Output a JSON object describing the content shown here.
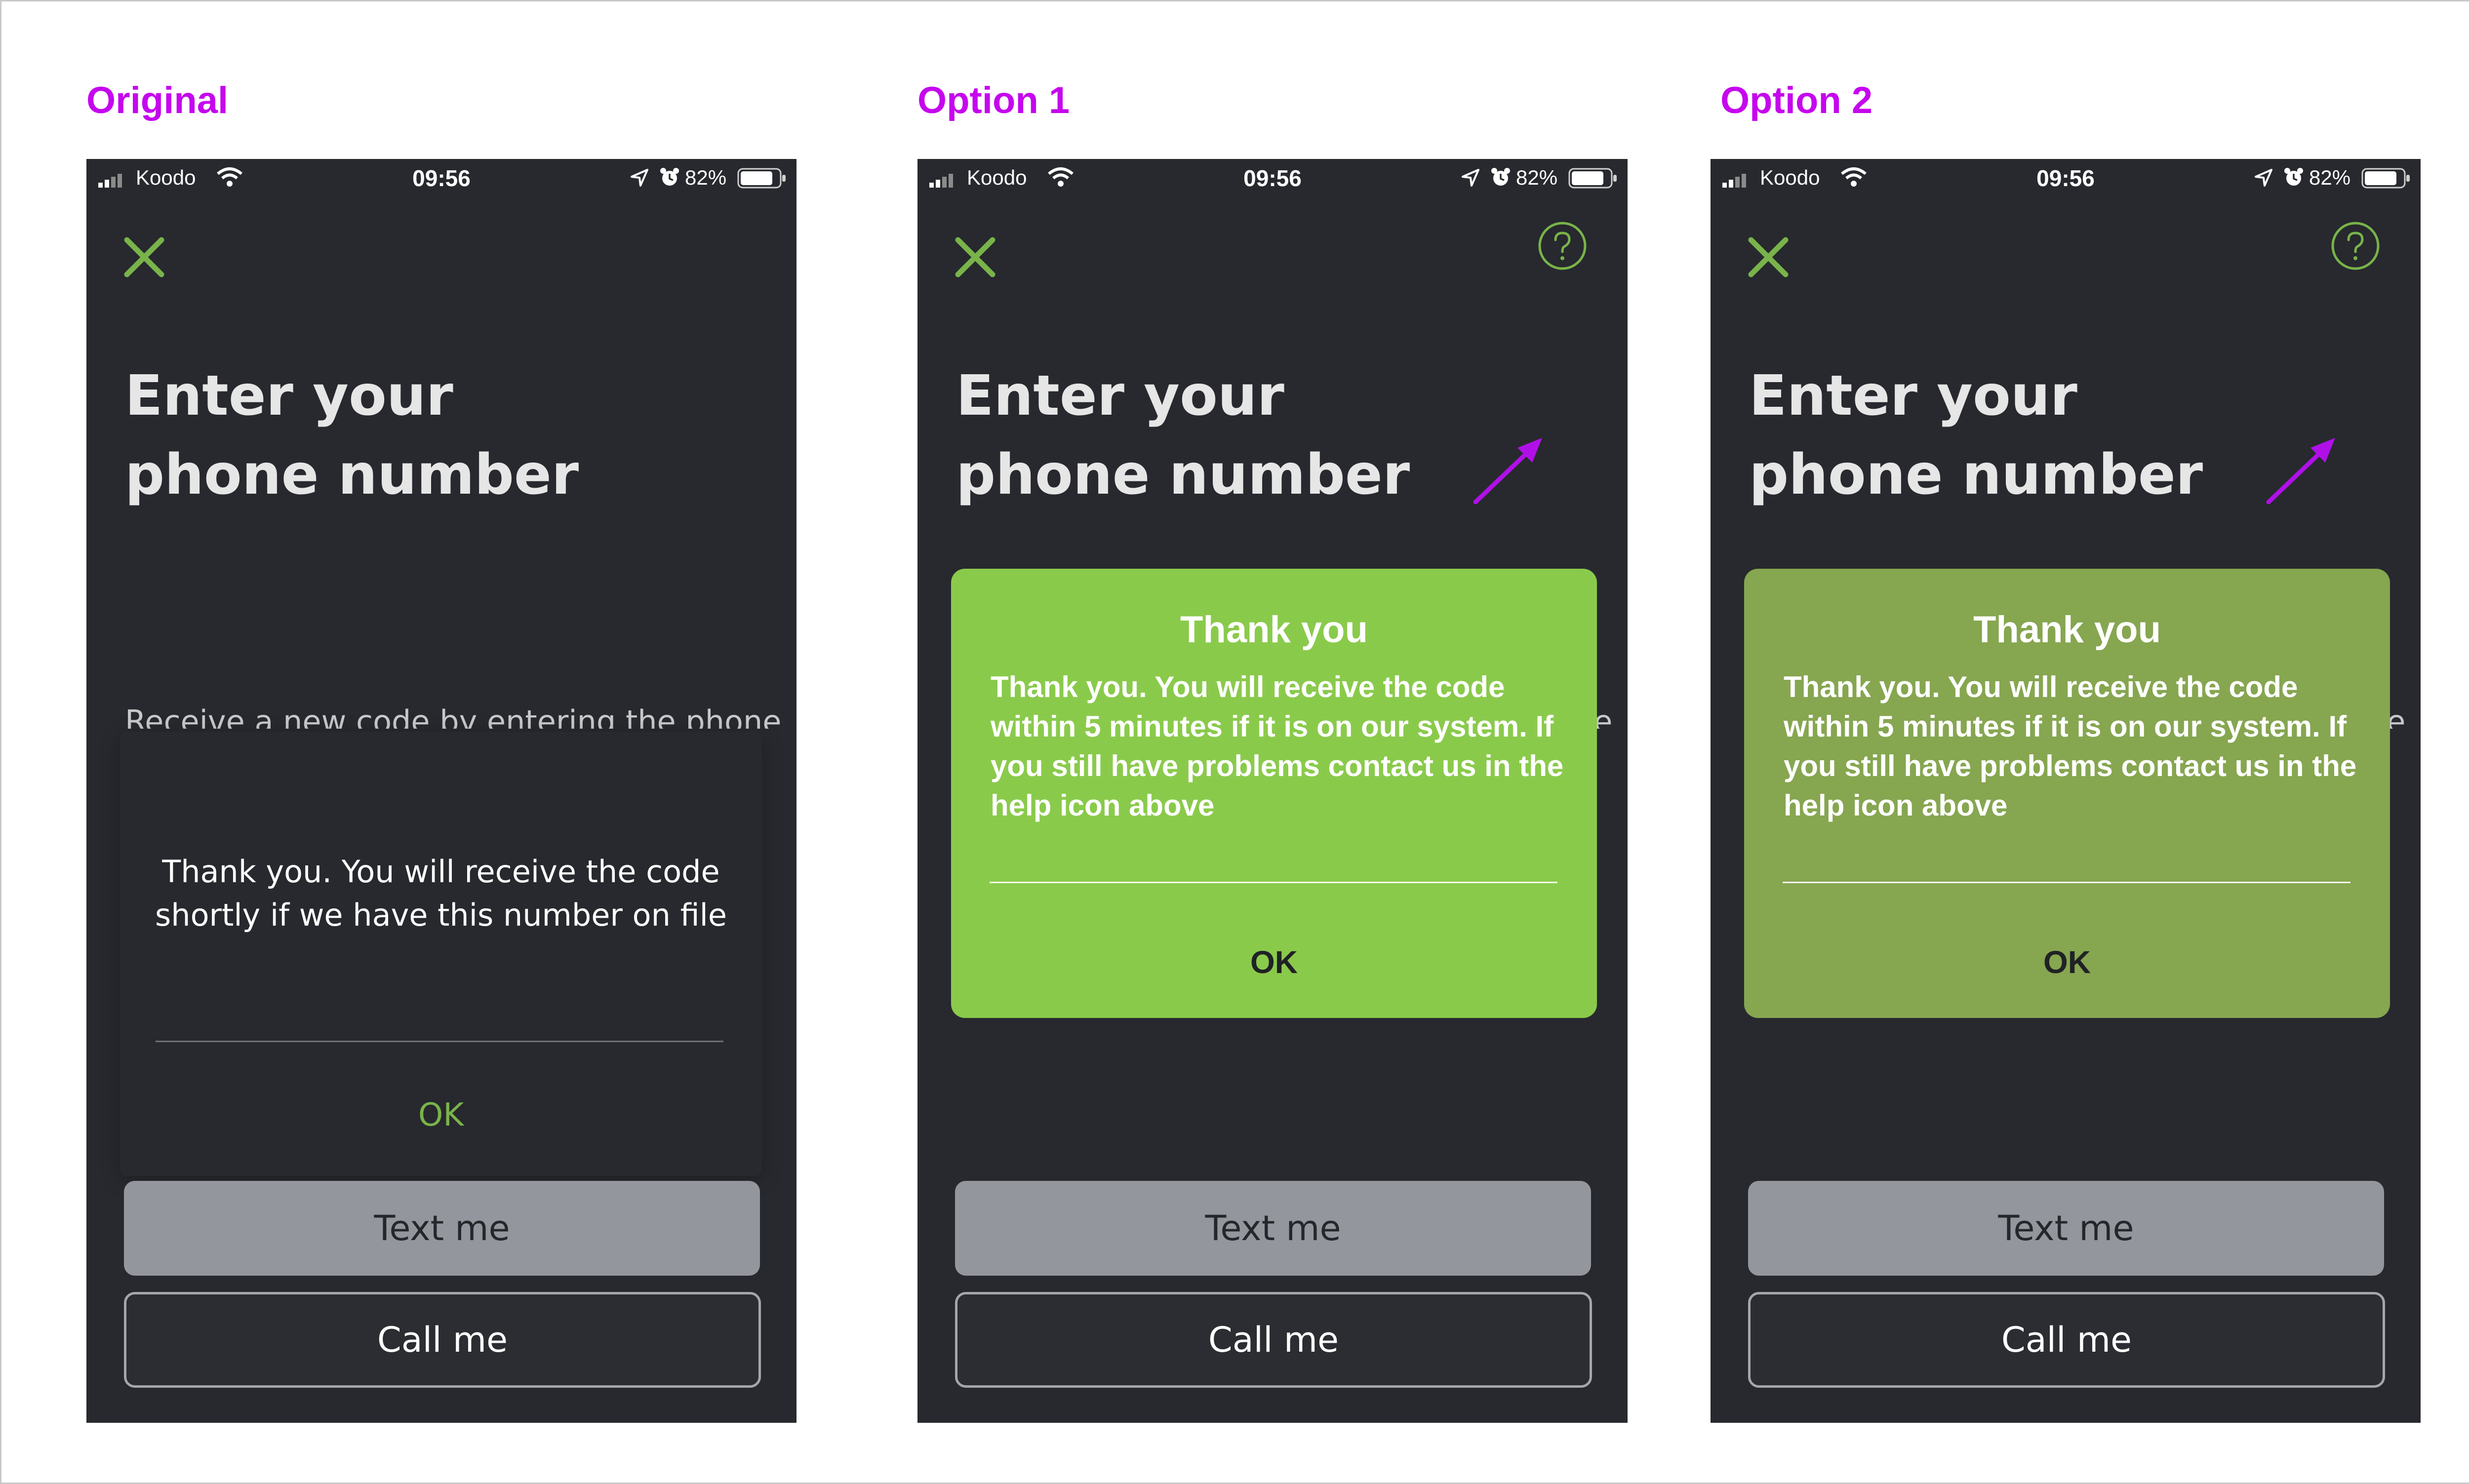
{
  "columns": [
    {
      "label": "Original",
      "variant": "original",
      "has_help_icon": false,
      "modal": {
        "title": "",
        "body": "Thank you. You will receive the code shortly if we have this number on file",
        "ok_label": "OK",
        "bg": "#27292e"
      }
    },
    {
      "label": "Option 1",
      "variant": "green-bright",
      "has_help_icon": true,
      "modal": {
        "title": "Thank you",
        "body": "Thank you. You will receive the code within 5 minutes if it is on our system. If you still have problems contact us in the help icon above",
        "ok_label": "OK",
        "bg": "#8aca4b"
      }
    },
    {
      "label": "Option 2",
      "variant": "green-muted",
      "has_help_icon": true,
      "modal": {
        "title": "Thank you",
        "body": "Thank you. You will receive the code within 5 minutes if it is on our system. If you still have problems contact us in the help icon above",
        "ok_label": "OK",
        "bg": "#86a650"
      }
    }
  ],
  "status_bar": {
    "carrier": "Koodo",
    "time": "09:56",
    "battery_percent": "82%",
    "icons": [
      "signal-icon",
      "wifi-icon",
      "location-arrow-icon",
      "alarm-clock-icon",
      "battery-icon"
    ]
  },
  "screen": {
    "title_line1": "Enter your",
    "title_line2": "phone number",
    "subtitle": "Receive a new code by entering the phone",
    "text_me_label": "Text me",
    "call_me_label": "Call me"
  },
  "colors": {
    "label_accent": "#c506ee",
    "screen_bg": "#27292e",
    "accent_green": "#79b34a",
    "option1_modal": "#8aca4b",
    "option2_modal": "#86a650",
    "arrow": "#b010e8"
  }
}
